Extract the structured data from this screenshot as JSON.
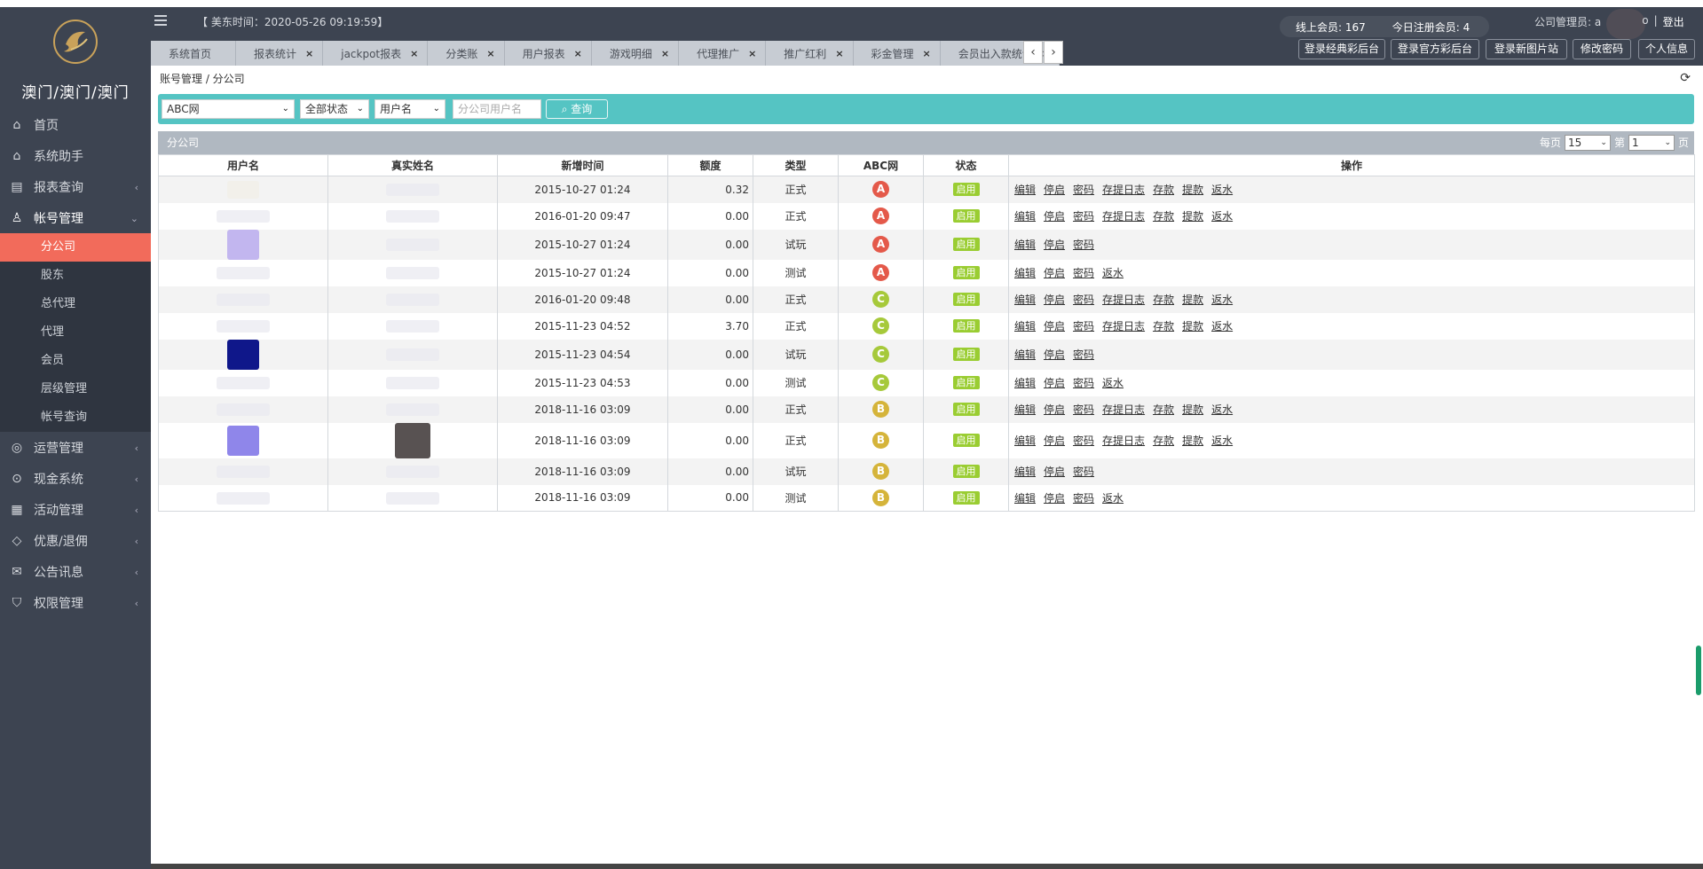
{
  "brand": {
    "title": "澳门/澳门/澳门"
  },
  "sidebar": {
    "items": [
      {
        "label": "首页",
        "icon": "home-icon"
      },
      {
        "label": "系统助手",
        "icon": "home-icon"
      },
      {
        "label": "报表查询",
        "icon": "report-icon",
        "chevron": "‹"
      },
      {
        "label": "帐号管理",
        "icon": "user-icon",
        "chevron": "⌄"
      }
    ],
    "subitems": [
      "分公司",
      "股东",
      "总代理",
      "代理",
      "会员",
      "层级管理",
      "帐号查询"
    ],
    "items2": [
      {
        "label": "运营管理",
        "icon": "globe-icon"
      },
      {
        "label": "现金系统",
        "icon": "cash-icon"
      },
      {
        "label": "活动管理",
        "icon": "calendar-icon"
      },
      {
        "label": "优惠/退佣",
        "icon": "tag-icon"
      },
      {
        "label": "公告讯息",
        "icon": "mail-icon"
      },
      {
        "label": "权限管理",
        "icon": "shield-icon"
      }
    ]
  },
  "header": {
    "time": "【 美东时间：2020-05-26 09:19:59】",
    "online_label": "线上会员:",
    "online_value": "167",
    "reg_label": "今日注册会员:",
    "reg_value": "4",
    "admin_label": "公司管理员: a",
    "admin_suffix": "o",
    "sep": "|",
    "logout": "登出",
    "buttons": [
      "登录经典彩后台",
      "登录官方彩后台",
      "登录新图片站",
      "修改密码",
      "个人信息"
    ]
  },
  "tabs": [
    {
      "label": "系统首页",
      "close": false
    },
    {
      "label": "报表统计",
      "close": true
    },
    {
      "label": "jackpot报表",
      "close": true
    },
    {
      "label": "分类账",
      "close": true
    },
    {
      "label": "用户报表",
      "close": true
    },
    {
      "label": "游戏明细",
      "close": true
    },
    {
      "label": "代理推广",
      "close": true
    },
    {
      "label": "推广红利",
      "close": true
    },
    {
      "label": "彩金管理",
      "close": true
    },
    {
      "label": "会员出入款统计",
      "close": true
    }
  ],
  "tab_arrows": {
    "left": "‹",
    "right": "›"
  },
  "breadcrumb": "账号管理 / 分公司",
  "refresh_icon": "⟳",
  "filter": {
    "site": "ABC网",
    "status": "全部状态",
    "field": "用户名",
    "placeholder": "分公司用户名",
    "search_label": "查询"
  },
  "panel": {
    "title": "分公司",
    "per_page_label": "每页",
    "per_page": "15",
    "page_label": "第",
    "page": "1",
    "page_suffix": "页"
  },
  "table": {
    "columns": [
      "用户名",
      "真实姓名",
      "新增时间",
      "额度",
      "类型",
      "ABC网",
      "状态",
      "操作"
    ],
    "rows": [
      {
        "time": "2015-10-27 01:24",
        "amount": "0.32",
        "type": "正式",
        "tclass": "formal",
        "site": "A",
        "status": "启用",
        "ops": [
          "编辑",
          "停启",
          "密码",
          "存提日志",
          "存款",
          "提款",
          "返水"
        ]
      },
      {
        "time": "2016-01-20 09:47",
        "amount": "0.00",
        "type": "正式",
        "tclass": "formal",
        "site": "A",
        "status": "启用",
        "ops": [
          "编辑",
          "停启",
          "密码",
          "存提日志",
          "存款",
          "提款",
          "返水"
        ]
      },
      {
        "time": "2015-10-27 01:24",
        "amount": "0.00",
        "type": "试玩",
        "tclass": "trial",
        "site": "A",
        "status": "启用",
        "ops": [
          "编辑",
          "停启",
          "密码"
        ]
      },
      {
        "time": "2015-10-27 01:24",
        "amount": "0.00",
        "type": "测试",
        "tclass": "test",
        "site": "A",
        "status": "启用",
        "ops": [
          "编辑",
          "停启",
          "密码",
          "返水"
        ]
      },
      {
        "time": "2016-01-20 09:48",
        "amount": "0.00",
        "type": "正式",
        "tclass": "formal",
        "site": "C",
        "status": "启用",
        "ops": [
          "编辑",
          "停启",
          "密码",
          "存提日志",
          "存款",
          "提款",
          "返水"
        ]
      },
      {
        "time": "2015-11-23 04:52",
        "amount": "3.70",
        "type": "正式",
        "tclass": "formal",
        "site": "C",
        "status": "启用",
        "ops": [
          "编辑",
          "停启",
          "密码",
          "存提日志",
          "存款",
          "提款",
          "返水"
        ]
      },
      {
        "time": "2015-11-23 04:54",
        "amount": "0.00",
        "type": "试玩",
        "tclass": "trial",
        "site": "C",
        "status": "启用",
        "ops": [
          "编辑",
          "停启",
          "密码"
        ]
      },
      {
        "time": "2015-11-23 04:53",
        "amount": "0.00",
        "type": "测试",
        "tclass": "test",
        "site": "C",
        "status": "启用",
        "ops": [
          "编辑",
          "停启",
          "密码",
          "返水"
        ]
      },
      {
        "time": "2018-11-16 03:09",
        "amount": "0.00",
        "type": "正式",
        "tclass": "formal",
        "site": "B",
        "status": "启用",
        "ops": [
          "编辑",
          "停启",
          "密码",
          "存提日志",
          "存款",
          "提款",
          "返水"
        ]
      },
      {
        "time": "2018-11-16 03:09",
        "amount": "0.00",
        "type": "正式",
        "tclass": "formal",
        "site": "B",
        "status": "启用",
        "ops": [
          "编辑",
          "停启",
          "密码",
          "存提日志",
          "存款",
          "提款",
          "返水"
        ]
      },
      {
        "time": "2018-11-16 03:09",
        "amount": "0.00",
        "type": "试玩",
        "tclass": "trial",
        "site": "B",
        "status": "启用",
        "ops": [
          "编辑",
          "停启",
          "密码"
        ]
      },
      {
        "time": "2018-11-16 03:09",
        "amount": "0.00",
        "type": "测试",
        "tclass": "test",
        "site": "B",
        "status": "启用",
        "ops": [
          "编辑",
          "停启",
          "密码",
          "返水"
        ]
      }
    ]
  },
  "colors": {
    "sidebar": "#3d4451",
    "active_sub": "#f26b5b",
    "filter_bar": "#55c4c3",
    "badge_A": "#e4594a",
    "badge_C": "#a6c93a",
    "badge_B": "#d5b43a",
    "status": "#9acd32"
  }
}
